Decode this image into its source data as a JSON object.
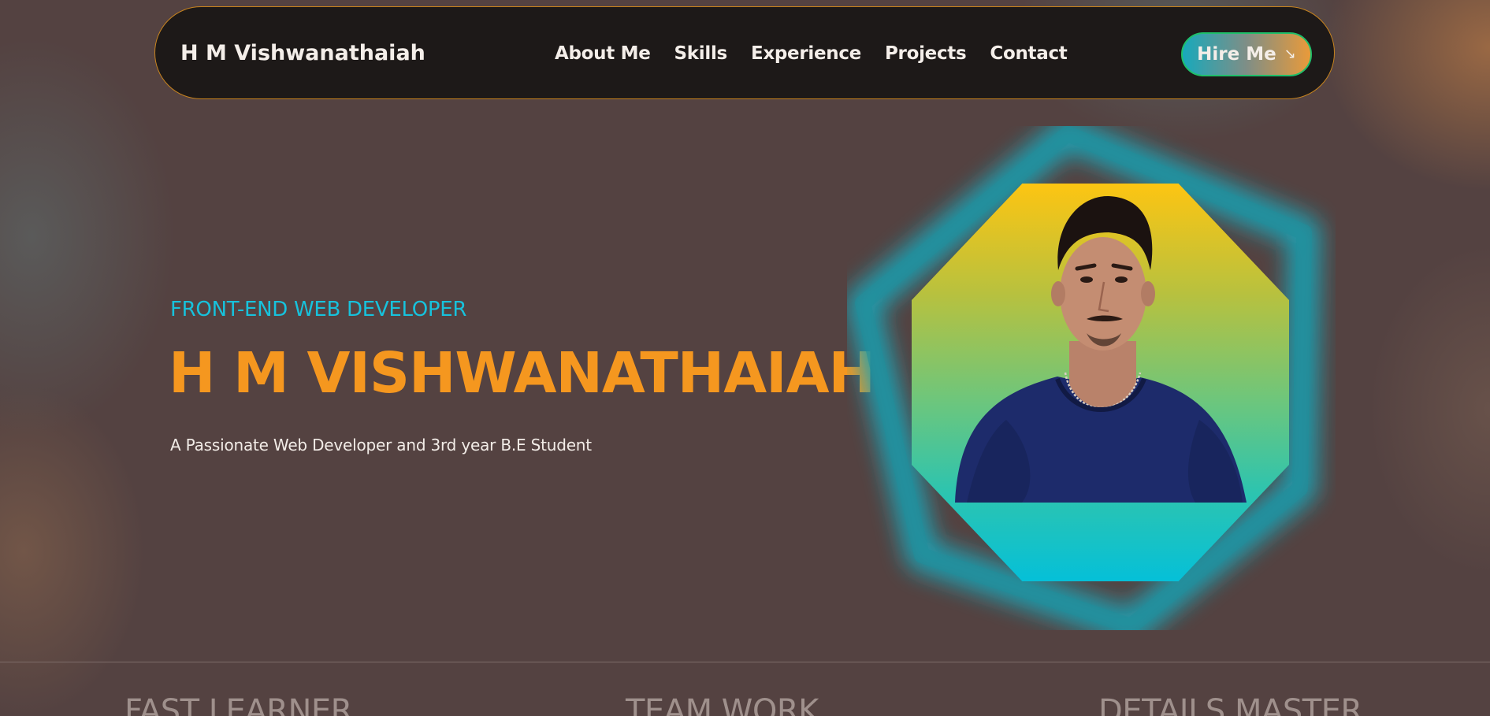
{
  "brand": "H M Vishwanathaiah",
  "nav": {
    "items": [
      {
        "label": "About Me"
      },
      {
        "label": "Skills"
      },
      {
        "label": "Experience"
      },
      {
        "label": "Projects"
      },
      {
        "label": "Contact"
      }
    ],
    "hire_label": "Hire Me",
    "hire_icon": "arrow-down-right-icon"
  },
  "hero": {
    "subtitle": "FRONT-END WEB DEVELOPER",
    "name": "H M VISHWANATHAIAH",
    "description": "A Passionate Web Developer and 3rd year B.E Student"
  },
  "features": [
    {
      "title": "FAST LEARNER"
    },
    {
      "title": "TEAM WORK"
    },
    {
      "title": "DETAILS MASTER"
    }
  ],
  "colors": {
    "accent_orange": "#f5971f",
    "accent_cyan": "#17c2dc",
    "navbar_bg": "#1d1918",
    "page_bg": "#544241"
  }
}
